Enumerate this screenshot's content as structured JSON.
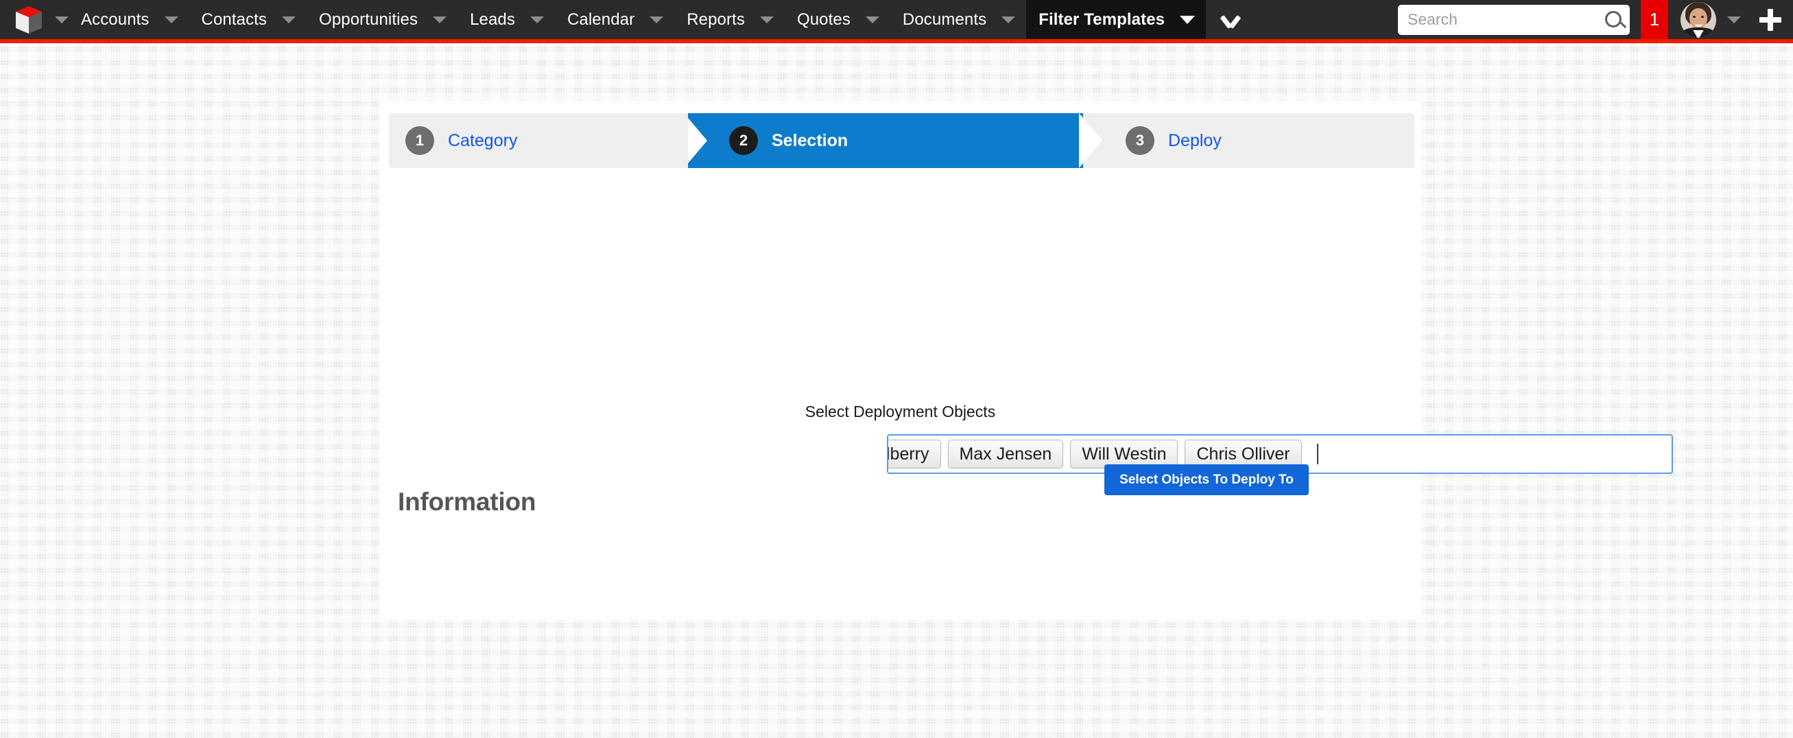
{
  "topnav": {
    "logo_icon": "cube-logo-icon",
    "logo_caret_icon": "chevron-down-icon",
    "items": [
      {
        "label": "Accounts",
        "caret_icon": "chevron-down-icon",
        "active": false
      },
      {
        "label": "Contacts",
        "caret_icon": "chevron-down-icon",
        "active": false
      },
      {
        "label": "Opportunities",
        "caret_icon": "chevron-down-icon",
        "active": false
      },
      {
        "label": "Leads",
        "caret_icon": "chevron-down-icon",
        "active": false
      },
      {
        "label": "Calendar",
        "caret_icon": "chevron-down-icon",
        "active": false
      },
      {
        "label": "Reports",
        "caret_icon": "chevron-down-icon",
        "active": false
      },
      {
        "label": "Quotes",
        "caret_icon": "chevron-down-icon",
        "active": false
      },
      {
        "label": "Documents",
        "caret_icon": "chevron-down-icon",
        "active": false
      },
      {
        "label": "Filter Templates",
        "caret_icon": "chevron-down-icon",
        "active": true
      }
    ],
    "more_icon": "chevron-down-icon",
    "search": {
      "placeholder": "Search",
      "value": "",
      "icon": "search-icon"
    },
    "notification_count": "1",
    "avatar_icon": "user-avatar",
    "avatar_caret_icon": "chevron-down-icon",
    "add_icon": "plus-icon",
    "accent_red": "#ef1c00",
    "bar_bg": "#2b2b2b",
    "active_tab_bg": "#131313",
    "badge_bg": "#e60000"
  },
  "wizard": {
    "steps": [
      {
        "number": "1",
        "label": "Category",
        "state": "inactive"
      },
      {
        "number": "2",
        "label": "Selection",
        "state": "active"
      },
      {
        "number": "3",
        "label": "Deploy",
        "state": "inactive"
      }
    ],
    "active_color": "#0d7cca",
    "inactive_bg": "#efefef",
    "inactive_text": "#1155ee"
  },
  "main": {
    "field_label": "Select Deployment Objects",
    "tokens": [
      {
        "label": "lberry",
        "clipped": true
      },
      {
        "label": "Max Jensen",
        "clipped": false
      },
      {
        "label": "Will Westin",
        "clipped": false
      },
      {
        "label": "Chris Olliver",
        "clipped": false
      }
    ],
    "input_value": "",
    "caret_visible": true,
    "information_heading": "Information",
    "deploy_button_label": "Select Objects To Deploy To",
    "deploy_button_color": "#1266d8",
    "focus_border_color": "#5b9bee"
  }
}
